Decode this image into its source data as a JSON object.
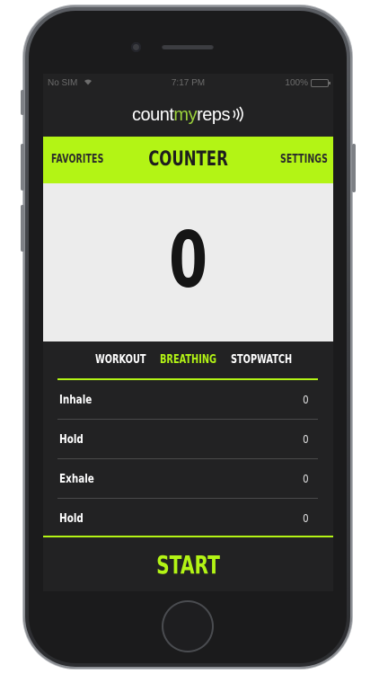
{
  "status_bar": {
    "carrier": "No SIM",
    "time": "7:17 PM",
    "battery": "100%"
  },
  "logo": {
    "part1": "count",
    "part2": "my",
    "part3": "reps"
  },
  "nav": {
    "left": "FAVORITES",
    "title": "COUNTER",
    "right": "SETTINGS"
  },
  "counter": {
    "value": "0"
  },
  "mode_tabs": [
    {
      "label": "WORKOUT",
      "active": false
    },
    {
      "label": "BREATHING",
      "active": true
    },
    {
      "label": "STOPWATCH",
      "active": false
    }
  ],
  "breathing_rows": [
    {
      "label": "Inhale",
      "value": "0"
    },
    {
      "label": "Hold",
      "value": "0"
    },
    {
      "label": "Exhale",
      "value": "0"
    },
    {
      "label": "Hold",
      "value": "0"
    }
  ],
  "start_button": {
    "label": "START"
  },
  "colors": {
    "accent": "#b3f415",
    "background": "#222223",
    "counter_bg": "#ececec"
  }
}
